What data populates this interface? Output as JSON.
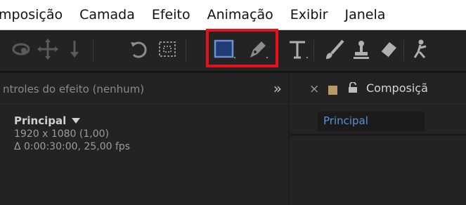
{
  "menu": {
    "items": [
      "mposição",
      "Camada",
      "Efeito",
      "Animação",
      "Exibir",
      "Janela"
    ]
  },
  "toolbar": {
    "tools": [
      "orbit-camera-icon",
      "pan-behind-icon",
      "move-down-icon",
      "rotate-icon",
      "region-of-interest-icon",
      "rectangle-tool-icon",
      "pen-tool-icon",
      "type-tool-icon",
      "brush-tool-icon",
      "clone-stamp-icon",
      "eraser-tool-icon",
      "puppet-pin-icon"
    ],
    "selected": "rectangle-tool-icon",
    "highlight_color": "#e8101b"
  },
  "effect_controls": {
    "title": "ntroles do efeito  (nenhum)",
    "expand_label": "»",
    "composition_name": "Principal",
    "resolution": "1920 x 1080 (1,00)",
    "duration": "Δ 0:00:30:00, 25,00 fps"
  },
  "composition_panel": {
    "close_label": "×",
    "title": "Composiçã",
    "tab_label": "Principal",
    "label_color": "#b79a63",
    "tab_text_color": "#5d8fd6"
  }
}
